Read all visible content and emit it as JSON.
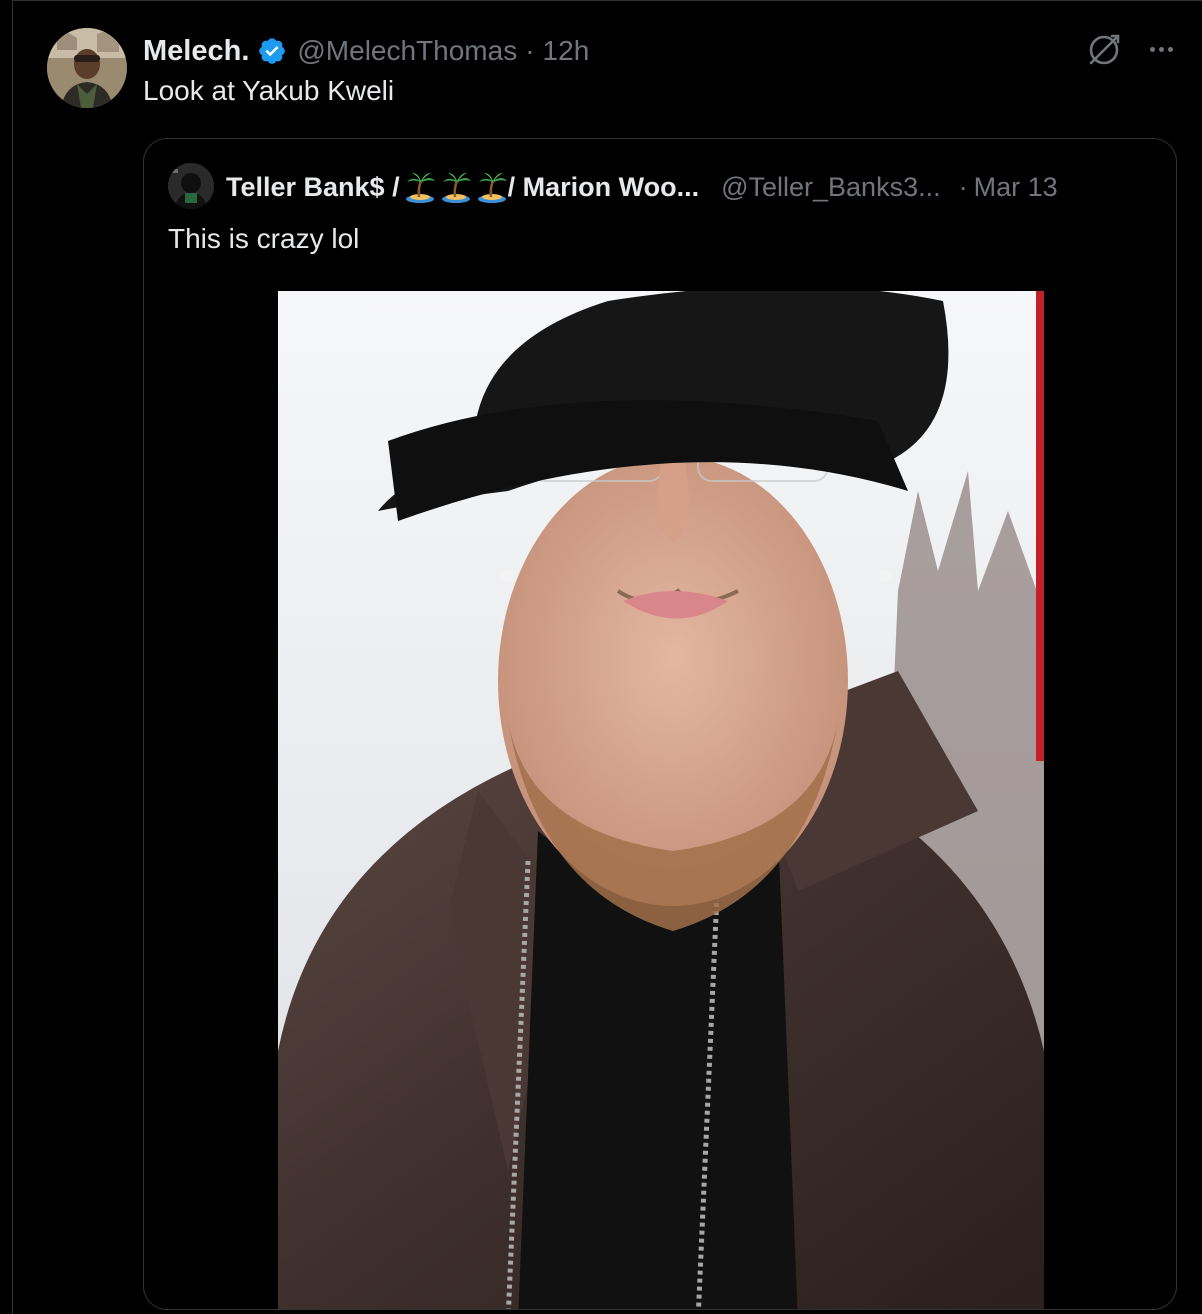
{
  "tweet": {
    "display_name": "Melech.",
    "handle": "@MelechThomas",
    "separator": "·",
    "time": "12h",
    "text": "Look at Yakub Kweli",
    "avatar_alt": "avatar"
  },
  "quote": {
    "display_name_part1": "Teller Bank$ /",
    "display_name_part2": "/ Marion Woo...",
    "handle": "@Teller_Banks3...",
    "separator": "·",
    "time": "Mar 13",
    "text": "This is crazy lol"
  },
  "icons": {
    "verified": "verified-badge-icon",
    "grok": "grok-icon",
    "more": "more-options-icon",
    "palm": "desert-island-emoji-icon"
  },
  "colors": {
    "background": "#000000",
    "primary_text": "#e7e9ea",
    "secondary_text": "#71767b",
    "border": "#2f3336",
    "verified_blue": "#1d9bf0"
  }
}
